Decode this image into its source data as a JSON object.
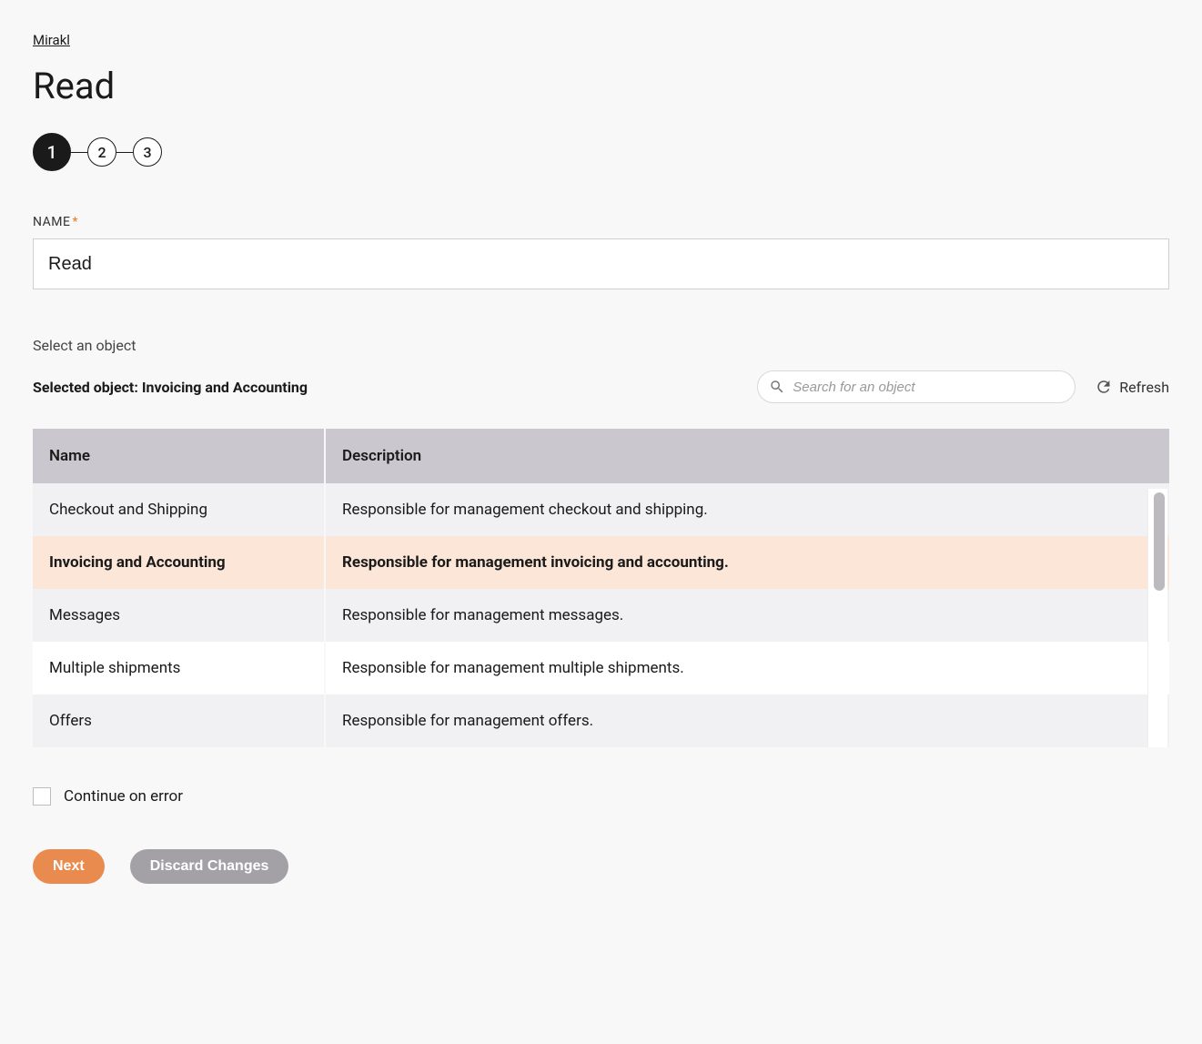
{
  "breadcrumb": {
    "label": "Mirakl"
  },
  "page": {
    "title": "Read"
  },
  "stepper": {
    "step1": "1",
    "step2": "2",
    "step3": "3"
  },
  "nameField": {
    "label": "NAME",
    "value": "Read"
  },
  "objectSection": {
    "select_label": "Select an object",
    "selected_prefix": "Selected object:",
    "selected_value": "Invoicing and Accounting"
  },
  "search": {
    "placeholder": "Search for an object"
  },
  "refresh": {
    "label": "Refresh"
  },
  "table": {
    "headers": {
      "name": "Name",
      "description": "Description"
    },
    "rows": [
      {
        "name": "Checkout and Shipping",
        "desc": "Responsible for management checkout and shipping."
      },
      {
        "name": "Invoicing and Accounting",
        "desc": "Responsible for management invoicing and accounting."
      },
      {
        "name": "Messages",
        "desc": "Responsible for management messages."
      },
      {
        "name": "Multiple shipments",
        "desc": "Responsible for management multiple shipments."
      },
      {
        "name": "Offers",
        "desc": "Responsible for management offers."
      }
    ],
    "selected_index": 1
  },
  "continueOnError": {
    "label": "Continue on error",
    "checked": false
  },
  "buttons": {
    "next": "Next",
    "discard": "Discard Changes"
  }
}
